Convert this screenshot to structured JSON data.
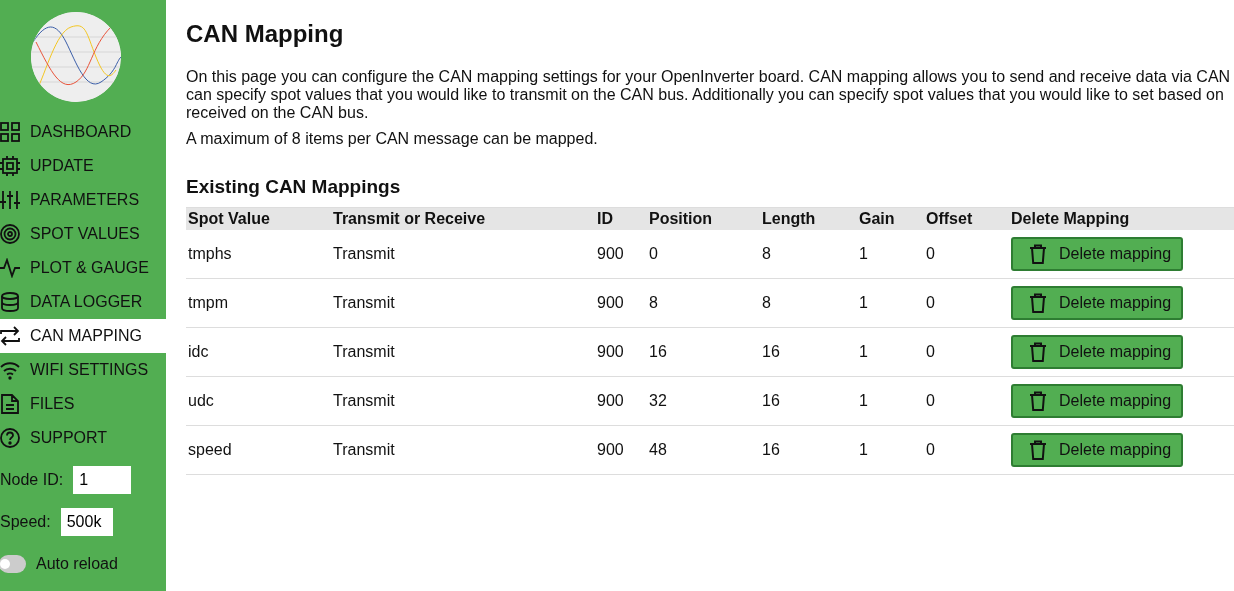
{
  "sidebar": {
    "items": [
      {
        "label": "DASHBOARD",
        "kind": "grid",
        "selected": false
      },
      {
        "label": "UPDATE",
        "kind": "chip",
        "selected": false
      },
      {
        "label": "PARAMETERS",
        "kind": "sliders",
        "selected": false
      },
      {
        "label": "SPOT VALUES",
        "kind": "target",
        "selected": false
      },
      {
        "label": "PLOT & GAUGE",
        "kind": "pulse",
        "selected": false
      },
      {
        "label": "DATA LOGGER",
        "kind": "database",
        "selected": false
      },
      {
        "label": "CAN MAPPING",
        "kind": "swap",
        "selected": true
      },
      {
        "label": "WIFI SETTINGS",
        "kind": "wifi",
        "selected": false
      },
      {
        "label": "FILES",
        "kind": "file",
        "selected": false
      },
      {
        "label": "SUPPORT",
        "kind": "help",
        "selected": false
      }
    ],
    "node_id": {
      "label": "Node ID:",
      "value": "1"
    },
    "speed": {
      "label": "Speed:",
      "value": "500k"
    },
    "auto_reload": {
      "label": "Auto reload",
      "on": false
    }
  },
  "title": "CAN Mapping",
  "intro_lines": [
    "On this page you can configure the CAN mapping settings for your OpenInverter board. CAN mapping allows you to send and receive data via CAN",
    "can specify spot values that you would like to transmit on the CAN bus. Additionally you can specify spot values that you would like to set based on",
    "received on the CAN bus."
  ],
  "note": "A maximum of 8 items per CAN message can be mapped.",
  "table": {
    "title": "Existing CAN Mappings",
    "columns": [
      "Spot Value",
      "Transmit or Receive",
      "ID",
      "Position",
      "Length",
      "Gain",
      "Offset",
      "Delete Mapping"
    ],
    "rows": [
      {
        "cells": [
          "tmphs",
          "Transmit",
          "900",
          "0",
          "8",
          "1",
          "0"
        ],
        "button": "Delete mapping"
      },
      {
        "cells": [
          "tmpm",
          "Transmit",
          "900",
          "8",
          "8",
          "1",
          "0"
        ],
        "button": "Delete mapping"
      },
      {
        "cells": [
          "idc",
          "Transmit",
          "900",
          "16",
          "16",
          "1",
          "0"
        ],
        "button": "Delete mapping"
      },
      {
        "cells": [
          "udc",
          "Transmit",
          "900",
          "32",
          "16",
          "1",
          "0"
        ],
        "button": "Delete mapping"
      },
      {
        "cells": [
          "speed",
          "Transmit",
          "900",
          "48",
          "16",
          "1",
          "0"
        ],
        "button": "Delete mapping"
      }
    ]
  }
}
